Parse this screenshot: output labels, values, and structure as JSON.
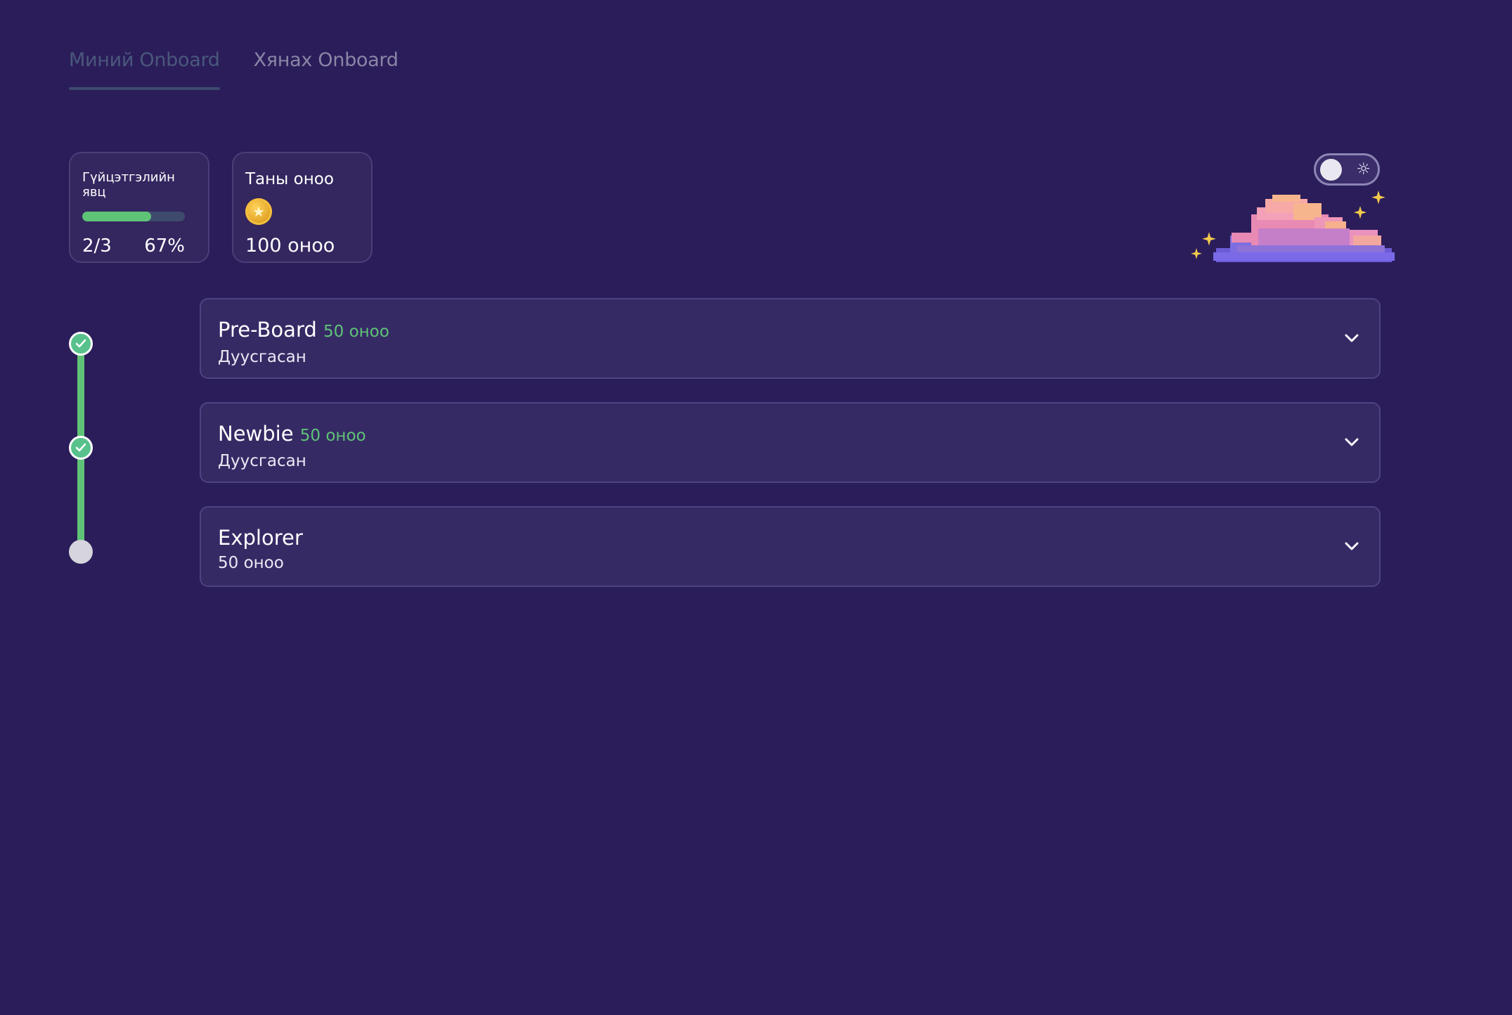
{
  "tabs": [
    {
      "label": "Миний Onboard",
      "active": true
    },
    {
      "label": "Хянах Onboard",
      "active": false
    }
  ],
  "progress_card": {
    "title": "Гүйцэтгэлийн явц",
    "completed": "2/3",
    "percent": "67%",
    "fraction": 0.67
  },
  "points_card": {
    "title": "Таны оноо",
    "icon": "coin-icon",
    "value": "100 оноо"
  },
  "theme_toggle": {
    "icon": "sun-icon",
    "mode": "dark"
  },
  "stages": [
    {
      "title": "Pre-Board",
      "points": "50 оноо",
      "subtitle": "Дуусгасан",
      "status": "done"
    },
    {
      "title": "Newbie",
      "points": "50 оноо",
      "subtitle": "Дуусгасан",
      "status": "done"
    },
    {
      "title": "Explorer",
      "points": "",
      "subtitle": "50 оноо",
      "status": "pending"
    }
  ],
  "colors": {
    "background": "#2b1d5a",
    "accent_green": "#5fc377",
    "card_bg": "#362a65",
    "card_border": "#4e4282"
  }
}
